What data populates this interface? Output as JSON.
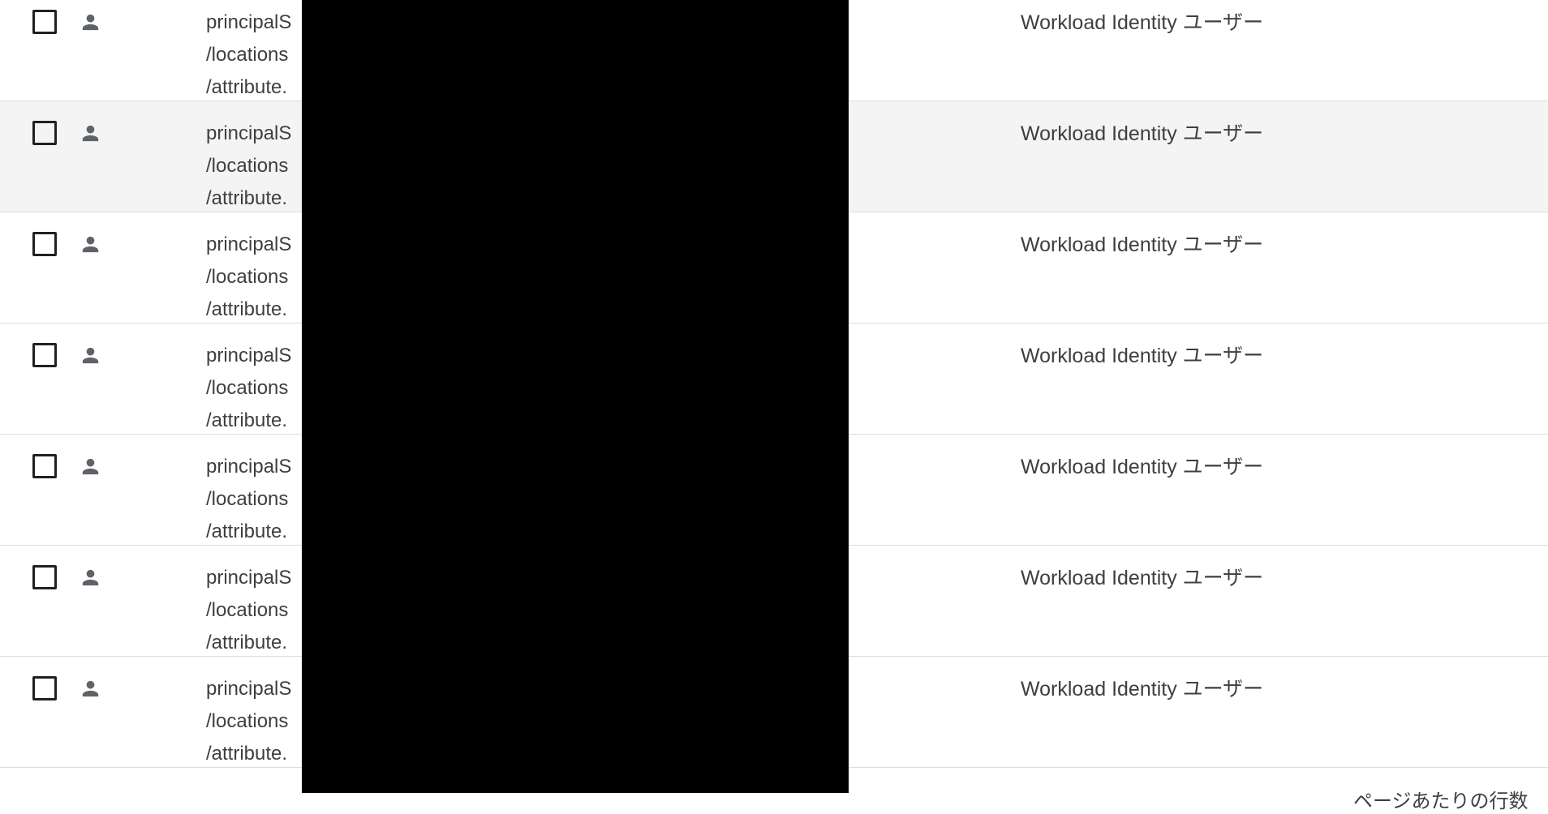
{
  "colors": {
    "text": "#3c4043",
    "divider": "#dadce0",
    "hover_row_bg": "#f4f4f4",
    "redaction": "#000000"
  },
  "icons": {
    "row_icon": "person-icon",
    "row_checkbox": "checkbox-unchecked"
  },
  "rows": [
    {
      "principal_line1": "principalS",
      "principal_line2": "/locations",
      "principal_line3": "/attribute.",
      "role": "Workload Identity ユーザー"
    },
    {
      "principal_line1": "principalS",
      "principal_line2": "/locations",
      "principal_line3": "/attribute.",
      "role": "Workload Identity ユーザー"
    },
    {
      "principal_line1": "principalS",
      "principal_line2": "/locations",
      "principal_line3": "/attribute.",
      "role": "Workload Identity ユーザー"
    },
    {
      "principal_line1": "principalS",
      "principal_line2": "/locations",
      "principal_line3": "/attribute.",
      "role": "Workload Identity ユーザー"
    },
    {
      "principal_line1": "principalS",
      "principal_line2": "/locations",
      "principal_line3": "/attribute.",
      "role": "Workload Identity ユーザー"
    },
    {
      "principal_line1": "principalS",
      "principal_line2": "/locations",
      "principal_line3": "/attribute.",
      "role": "Workload Identity ユーザー"
    },
    {
      "principal_line1": "principalS",
      "principal_line2": "/locations",
      "principal_line3": "/attribute.",
      "role": "Workload Identity ユーザー"
    }
  ],
  "footer": {
    "rows_per_page_label": "ページあたりの行数"
  }
}
